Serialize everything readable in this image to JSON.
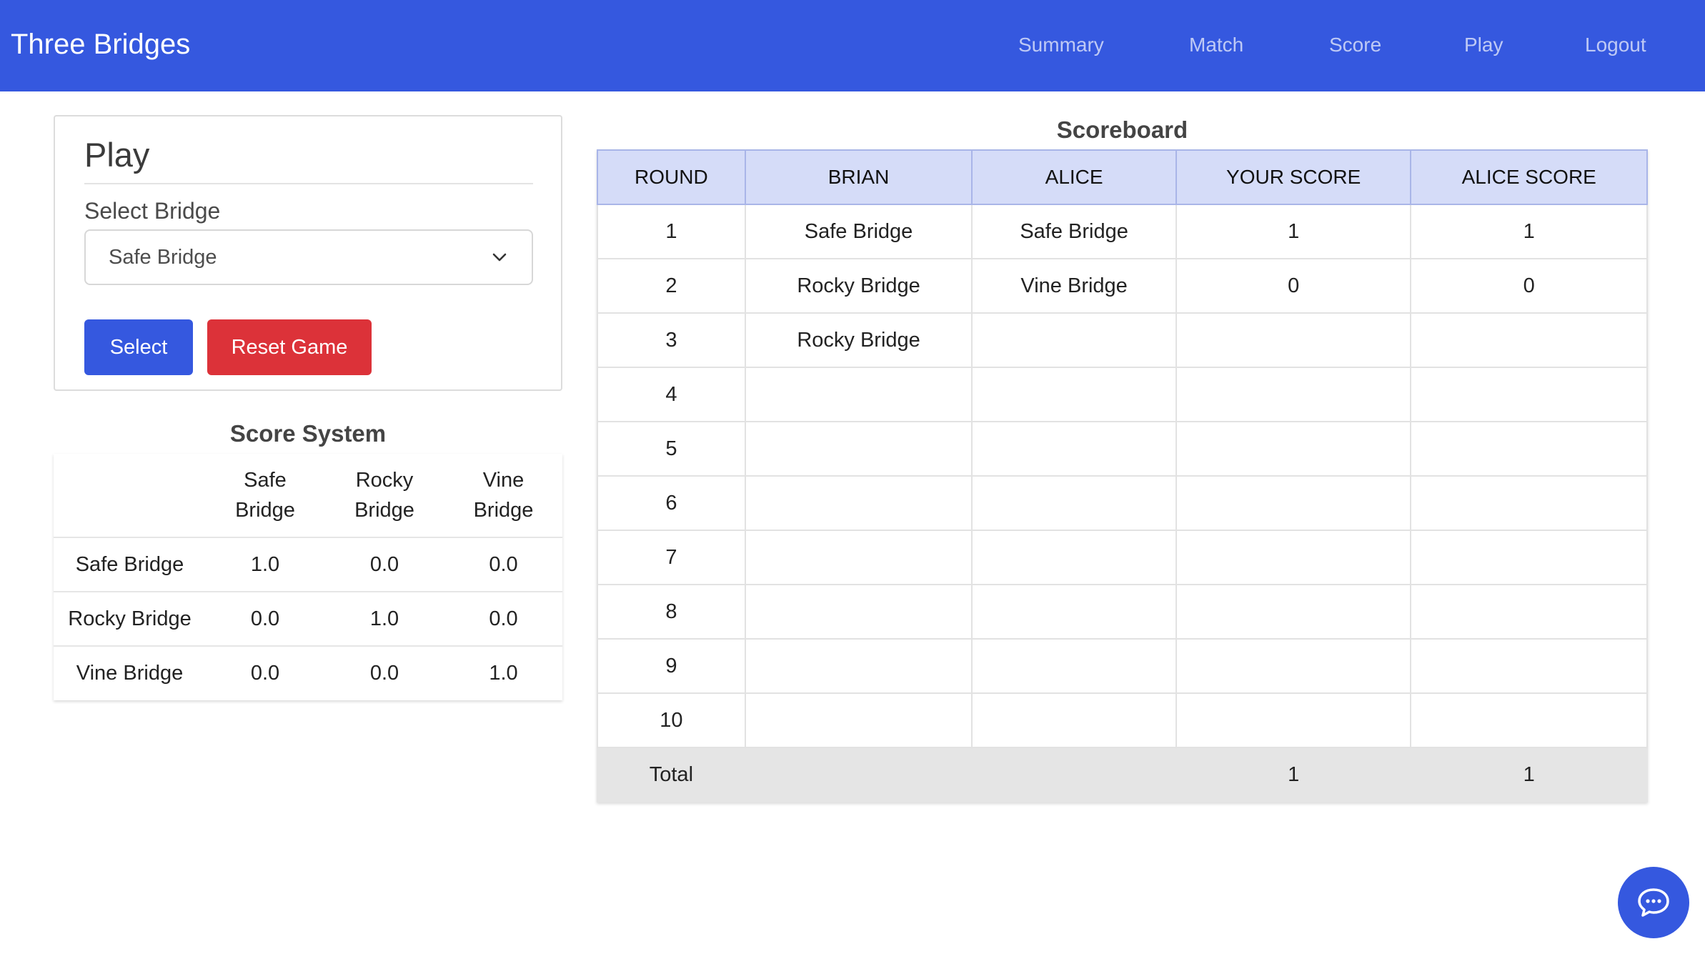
{
  "navbar": {
    "brand": "Three Bridges",
    "links": [
      "Summary",
      "Match",
      "Score",
      "Play",
      "Logout"
    ],
    "color": "#3558df"
  },
  "play": {
    "title": "Play",
    "select_label": "Select Bridge",
    "selected_value": "Safe Bridge",
    "select_button": "Select",
    "reset_button": "Reset Game"
  },
  "score_system": {
    "title": "Score System",
    "headers": [
      "",
      "Safe Bridge",
      "Rocky Bridge",
      "Vine Bridge"
    ],
    "rows": [
      [
        "Safe Bridge",
        "1.0",
        "0.0",
        "0.0"
      ],
      [
        "Rocky Bridge",
        "0.0",
        "1.0",
        "0.0"
      ],
      [
        "Vine Bridge",
        "0.0",
        "0.0",
        "1.0"
      ]
    ]
  },
  "scoreboard": {
    "title": "Scoreboard",
    "headers": [
      "ROUND",
      "BRIAN",
      "ALICE",
      "YOUR SCORE",
      "ALICE SCORE"
    ],
    "rows": [
      [
        "1",
        "Safe Bridge",
        "Safe Bridge",
        "1",
        "1"
      ],
      [
        "2",
        "Rocky Bridge",
        "Vine Bridge",
        "0",
        "0"
      ],
      [
        "3",
        "Rocky Bridge",
        "",
        "",
        ""
      ],
      [
        "4",
        "",
        "",
        "",
        ""
      ],
      [
        "5",
        "",
        "",
        "",
        ""
      ],
      [
        "6",
        "",
        "",
        "",
        ""
      ],
      [
        "7",
        "",
        "",
        "",
        ""
      ],
      [
        "8",
        "",
        "",
        "",
        ""
      ],
      [
        "9",
        "",
        "",
        "",
        ""
      ],
      [
        "10",
        "",
        "",
        "",
        ""
      ]
    ],
    "total": [
      "Total",
      "",
      "",
      "1",
      "1"
    ]
  },
  "chat": {
    "icon": "chat-bubble-icon"
  },
  "colors": {
    "primary": "#3558df",
    "danger": "#dc3239",
    "header_bg": "#d5dcf8"
  }
}
